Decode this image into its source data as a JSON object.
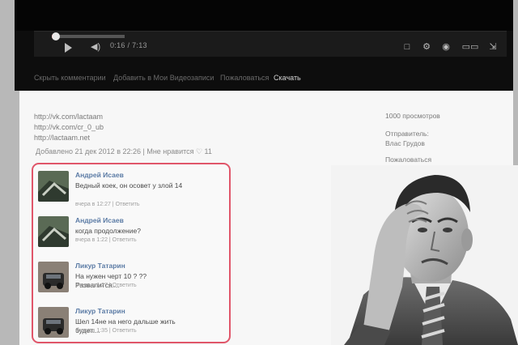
{
  "player": {
    "time": "0:16 / 7:13",
    "progress_fraction": 0.06
  },
  "tabs": [
    {
      "label": "Скрыть комментарии",
      "active": false
    },
    {
      "label": "Добавить в Мои Видеозаписи",
      "active": false
    },
    {
      "label": "Пожаловаться",
      "active": false
    },
    {
      "label": "Скачать",
      "active": true
    }
  ],
  "description": {
    "links": [
      "http://vk.com/lactaam",
      "http://vk.com/cr_0_ub",
      "http://lactaam.net"
    ],
    "added": "Добавлено 21 дек 2012 в 22:26 | Мне нравится ♡ 11"
  },
  "sidebar": {
    "views": "1000 просмотров",
    "sender_label": "Отправитель:",
    "sender_name": "Влас Грудов",
    "complain": "Пожаловаться"
  },
  "comments": [
    {
      "author": "Андрей Исаев",
      "text": "Ведный коек, он осовет у злой 14",
      "meta": "вчера в 12:27 | Ответить"
    },
    {
      "author": "Андрей Исаев",
      "text": "когда продолжение?",
      "meta": "вчера в 1:22 | Ответить"
    },
    {
      "author": "Ликур Татарин",
      "text": "На нужен черт 10 ? ?? Развалится....",
      "meta": "вчера в 1:27 | Ответить"
    },
    {
      "author": "Ликур Татарин",
      "text": "Шел 14не на него дальше жить будет....",
      "meta": "вчера в 1:35 | Ответить"
    }
  ]
}
